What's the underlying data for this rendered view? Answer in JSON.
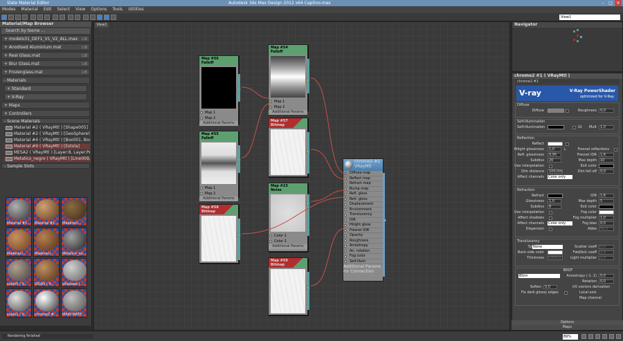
{
  "titlebar": {
    "app": "Slate Material Editor",
    "doc": "Autodesk 3ds Max Design 2012 x64      Captino.max"
  },
  "menu": [
    "Modes",
    "Material",
    "Edit",
    "Select",
    "View",
    "Options",
    "Tools",
    "Utilities"
  ],
  "toolbar": {
    "view_select": "View1"
  },
  "browser": {
    "title": "Material/Map Browser",
    "search_placeholder": "Search by Name ...",
    "libraries": [
      {
        "name": "+ modelo31_DEF1_V1_V2_ALL.max",
        "tag": "LIB"
      },
      {
        "name": "+ Anodised Aluminium.mat",
        "tag": "LIB"
      },
      {
        "name": "+ Real Glass.mat",
        "tag": "LIB"
      },
      {
        "name": "+ Blur Glass.mat",
        "tag": "LIB"
      },
      {
        "name": "+ Frozenglass.mat",
        "tag": "LIB"
      }
    ],
    "materials_header": "- Materials",
    "materials_sub": [
      "+ Standard",
      "+ V-Ray"
    ],
    "maps_header": "+ Maps",
    "controllers_header": "+ Controllers",
    "scene_header": "- Scene Materials",
    "scene_items": [
      "Material #2 ( VRayMtl ) [Shape005]",
      "Material #2 ( VRayMtl ) [GeoSphere00...",
      "Material #4 ( VRayMtl ) [Box001, Box0...",
      "Material #9 ( VRayMtl ) [Estola]",
      "MESA2 ( VRayMtl ) [Layer:8, Layer:Pel...",
      "Metalico_negro ( VRayMtl ) [Line009, Li..."
    ],
    "slots_header": "- Sample Slots",
    "slots": [
      {
        "label": "Material #1...",
        "c1": "#b0b0b0",
        "c2": "#303030"
      },
      {
        "label": "Material #1...",
        "c1": "#d0a070",
        "c2": "#5a3a20"
      },
      {
        "label": "Maderaci...",
        "c1": "#8a6a40",
        "c2": "#3a2a15"
      },
      {
        "label": "Maderaci...",
        "c1": "#c89060",
        "c2": "#6a4020"
      },
      {
        "label": "Maderaci...",
        "c1": "#b88050",
        "c2": "#50301a"
      },
      {
        "label": "Metalico_ne...",
        "c1": "#a0a0a0",
        "c2": "#202020"
      },
      {
        "label": "suelo5 ( V...",
        "c1": "#b0a090",
        "c2": "#404040"
      },
      {
        "label": "VIGAS ( V...",
        "c1": "#c09060",
        "c2": "#503018"
      },
      {
        "label": "sillaaaaa ( ...",
        "c1": "#d0d0d0",
        "c2": "#606060"
      },
      {
        "label": "suelo1 ( V...",
        "c1": "#e0e0e0",
        "c2": "#404040"
      },
      {
        "label": "chrome2 #...",
        "c1": "#ffffff",
        "c2": "#303030"
      },
      {
        "label": "MAIN MATE...",
        "c1": "#c0c0c0",
        "c2": "#505050"
      }
    ]
  },
  "view": {
    "tab": "View1"
  },
  "nodes": {
    "map56": {
      "title": "Map #56",
      "type": "Falloff",
      "pins": [
        "Map 1",
        "Map 2"
      ],
      "additional": "Additional Params"
    },
    "map55": {
      "title": "Map #55",
      "type": "Falloff",
      "pins": [
        "Map 1",
        "Map 2"
      ],
      "additional": "Additional Params"
    },
    "map58": {
      "title": "Map #58",
      "type": "Bitmap"
    },
    "map54": {
      "title": "Map #54",
      "type": "Falloff",
      "pins": [
        "Map 1",
        "Map 2"
      ],
      "additional": "Additional Params"
    },
    "map57": {
      "title": "Map #57",
      "type": "Bitmap"
    },
    "map23": {
      "title": "Map #23",
      "type": "Noise",
      "pins": [
        "Color 1",
        "Color 2"
      ],
      "additional": "Additional Params"
    },
    "map59": {
      "title": "Map #59",
      "type": "Bitmap"
    },
    "chrome": {
      "title": "chrome2 #1",
      "type": "VRayMtl",
      "pins": [
        "Diffuse map",
        "Reflect map",
        "Refract map",
        "Bump map",
        "Refl. gloss",
        "Refr. gloss",
        "Displacement",
        "Environment",
        "Translucency",
        "IOR",
        "Hilight gloss",
        "Fresnel IOR",
        "Opacity",
        "Roughness",
        "Anisotropy",
        "An. rotation",
        "Fog color",
        "Self-illum"
      ],
      "additional": "Additional Params",
      "mr": "mr Connection"
    }
  },
  "navigator": {
    "title": "Navigator"
  },
  "params": {
    "title": "chrome2 #1  ( VRayMtl )",
    "subtitle": "chrome2 #1",
    "vray_logo": "V-ray",
    "vray_t1": "V-Ray PowerShader",
    "vray_t2": "optimized for V-Ray",
    "diffuse": {
      "group": "Diffuse",
      "label": "Diffuse",
      "m": "M",
      "roughness_label": "Roughness",
      "roughness": "0,0"
    },
    "selfillum": {
      "group": "Self-illumination",
      "label": "Self-illumination",
      "gi": "GI",
      "mult_label": "Mult",
      "mult": "1,0"
    },
    "reflection": {
      "group": "Reflection",
      "reflect_label": "Reflect",
      "m": "M",
      "hilight_label": "Hilight glossiness",
      "hilight": "1,0",
      "l": "L",
      "fresnel_label": "Fresnel reflections",
      "refl_label": "Refl. glossiness",
      "refl": "0,95",
      "fior_label": "Fresnel IOR",
      "fior": "1,6",
      "subdivs_label": "Subdivs",
      "subdivs": "20",
      "maxdepth_label": "Max depth",
      "maxdepth": "10",
      "interp_label": "Use interpolation",
      "exit_label": "Exit color",
      "dim_label": "Dim distance",
      "dim": "100,0m",
      "falloff_label": "Dim fall off",
      "falloff": "0,0",
      "affect_label": "Affect channels",
      "affect": "Color only"
    },
    "refraction": {
      "group": "Refraction",
      "refract_label": "Refract",
      "ior_label": "IOR",
      "ior": "1,6",
      "gloss_label": "Glossiness",
      "gloss": "1,0",
      "maxdepth_label": "Max depth",
      "maxdepth": "5",
      "subdivs_label": "Subdivs",
      "subdivs": "8",
      "exit_label": "Exit color",
      "interp_label": "Use interpolation",
      "fog_label": "Fog color",
      "shadows_label": "Affect shadows",
      "fogmult_label": "Fog multiplier",
      "fogmult": "1,0",
      "affect_label": "Affect channels",
      "affect": "Color only",
      "fogbias_label": "Fog bias",
      "fogbias": "0,0",
      "disp_label": "Dispersion",
      "abbe_label": "Abbe",
      "abbe": "50,0"
    },
    "translucency": {
      "group": "Translucency",
      "type_label": "Type",
      "type": "None",
      "scatter_label": "Scatter coeff",
      "scatter": "0,0",
      "back_label": "Back-side color",
      "fwd_label": "Fwd/bck coeff",
      "fwd": "1,0",
      "thick_label": "Thickness",
      "thick": "1000,0",
      "light_label": "Light multiplier",
      "light": "1,0"
    },
    "brdf": {
      "group": "BRDF",
      "type": "Blinn",
      "aniso_label": "Anisotropy (-1..1)",
      "aniso": "0,0",
      "rot_label": "Rotation",
      "rot": "0,0",
      "soften_label": "Soften",
      "soften": "0,0",
      "uv_label": "UV vectors derivation",
      "local_label": "Local axis",
      "map_label": "Map channel",
      "fix_label": "Fix dark glossy edges"
    },
    "options": "Options",
    "maps": "Maps"
  },
  "status": {
    "text": "Rendering finished",
    "zoom": "89%"
  }
}
